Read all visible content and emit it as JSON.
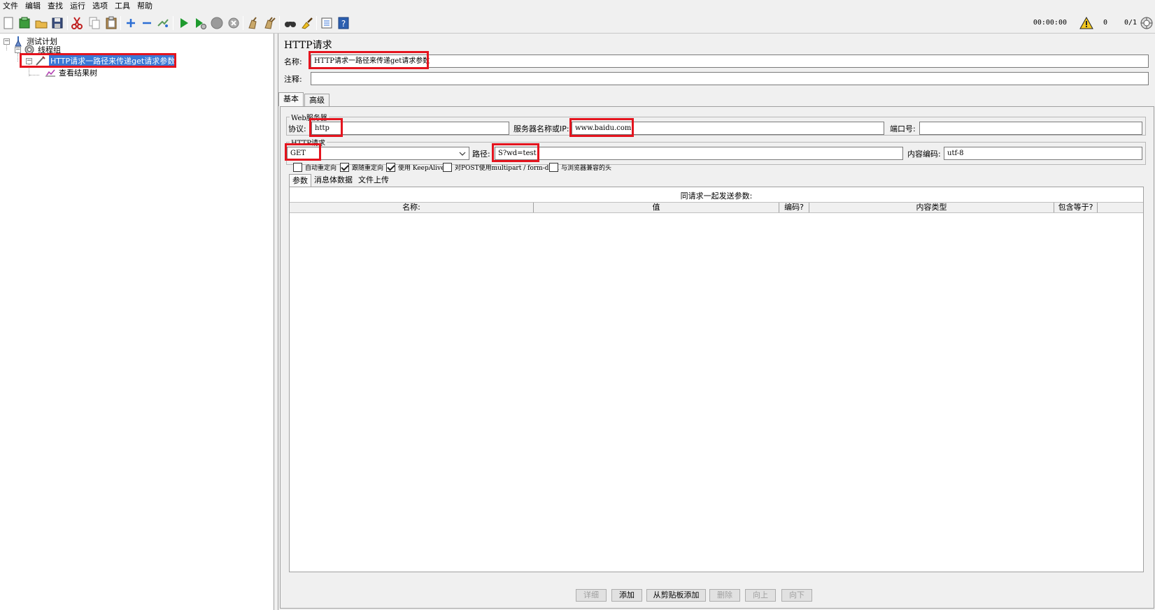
{
  "menubar": {
    "items": [
      "文件",
      "编辑",
      "查找",
      "运行",
      "选项",
      "工具",
      "帮助"
    ]
  },
  "toolbar": {
    "icons": [
      "new-icon",
      "templates-icon",
      "open-icon",
      "save-icon",
      "cut-icon",
      "copy-icon",
      "paste-icon",
      "expand-icon",
      "collapse-icon",
      "toggle-icon",
      "start-icon",
      "start-no-pause-icon",
      "stop-icon",
      "shutdown-icon",
      "clear-icon",
      "clear-all-icon",
      "search-icon",
      "reset-search-icon",
      "function-helper-icon",
      "help-icon"
    ],
    "timer": "00:00:00",
    "warning_count": "0",
    "thread_count": "0/1"
  },
  "tree": {
    "nodes": [
      {
        "label": "测试计划",
        "icon": "test-plan-icon"
      },
      {
        "label": "线程组",
        "icon": "thread-group-icon"
      },
      {
        "label": "HTTP请求一路径来传递get请求参数",
        "icon": "http-sampler-icon"
      },
      {
        "label": "查看结果树",
        "icon": "listener-icon"
      }
    ]
  },
  "sampler": {
    "title": "HTTP请求",
    "name_label": "名称:",
    "name_value": "HTTP请求一路径来传递get请求参数",
    "comment_label": "注释:",
    "comment_value": "",
    "tabs": [
      "基本",
      "高级"
    ],
    "web_server": {
      "legend": "Web服务器",
      "protocol_label": "协议:",
      "protocol_value": "http",
      "server_label": "服务器名称或IP:",
      "server_value": "www.baidu.com",
      "port_label": "端口号:",
      "port_value": ""
    },
    "http_request": {
      "legend": "HTTP请求",
      "method": "GET",
      "path_label": "路径:",
      "path_value": "S?wd=test",
      "encoding_label": "内容编码:",
      "encoding_value": "utf-8"
    },
    "checkboxes": [
      {
        "label": "自动重定向",
        "checked": false
      },
      {
        "label": "跟随重定向",
        "checked": true
      },
      {
        "label": "使用 KeepAlive",
        "checked": true
      },
      {
        "label": "对POST使用multipart / form-data",
        "checked": false
      },
      {
        "label": "与浏览器兼容的头",
        "checked": false
      }
    ],
    "subtabs": [
      "参数",
      "消息体数据",
      "文件上传"
    ],
    "params_title": "同请求一起发送参数:",
    "columns": [
      "名称:",
      "值",
      "编码?",
      "内容类型",
      "包含等于?"
    ],
    "buttons": [
      {
        "label": "详细",
        "enabled": false
      },
      {
        "label": "添加",
        "enabled": true
      },
      {
        "label": "从剪贴板添加",
        "enabled": true
      },
      {
        "label": "删除",
        "enabled": false
      },
      {
        "label": "向上",
        "enabled": false
      },
      {
        "label": "向下",
        "enabled": false
      }
    ]
  },
  "colors": {
    "highlight": "#e4141e",
    "selection": "#3a78d6"
  }
}
